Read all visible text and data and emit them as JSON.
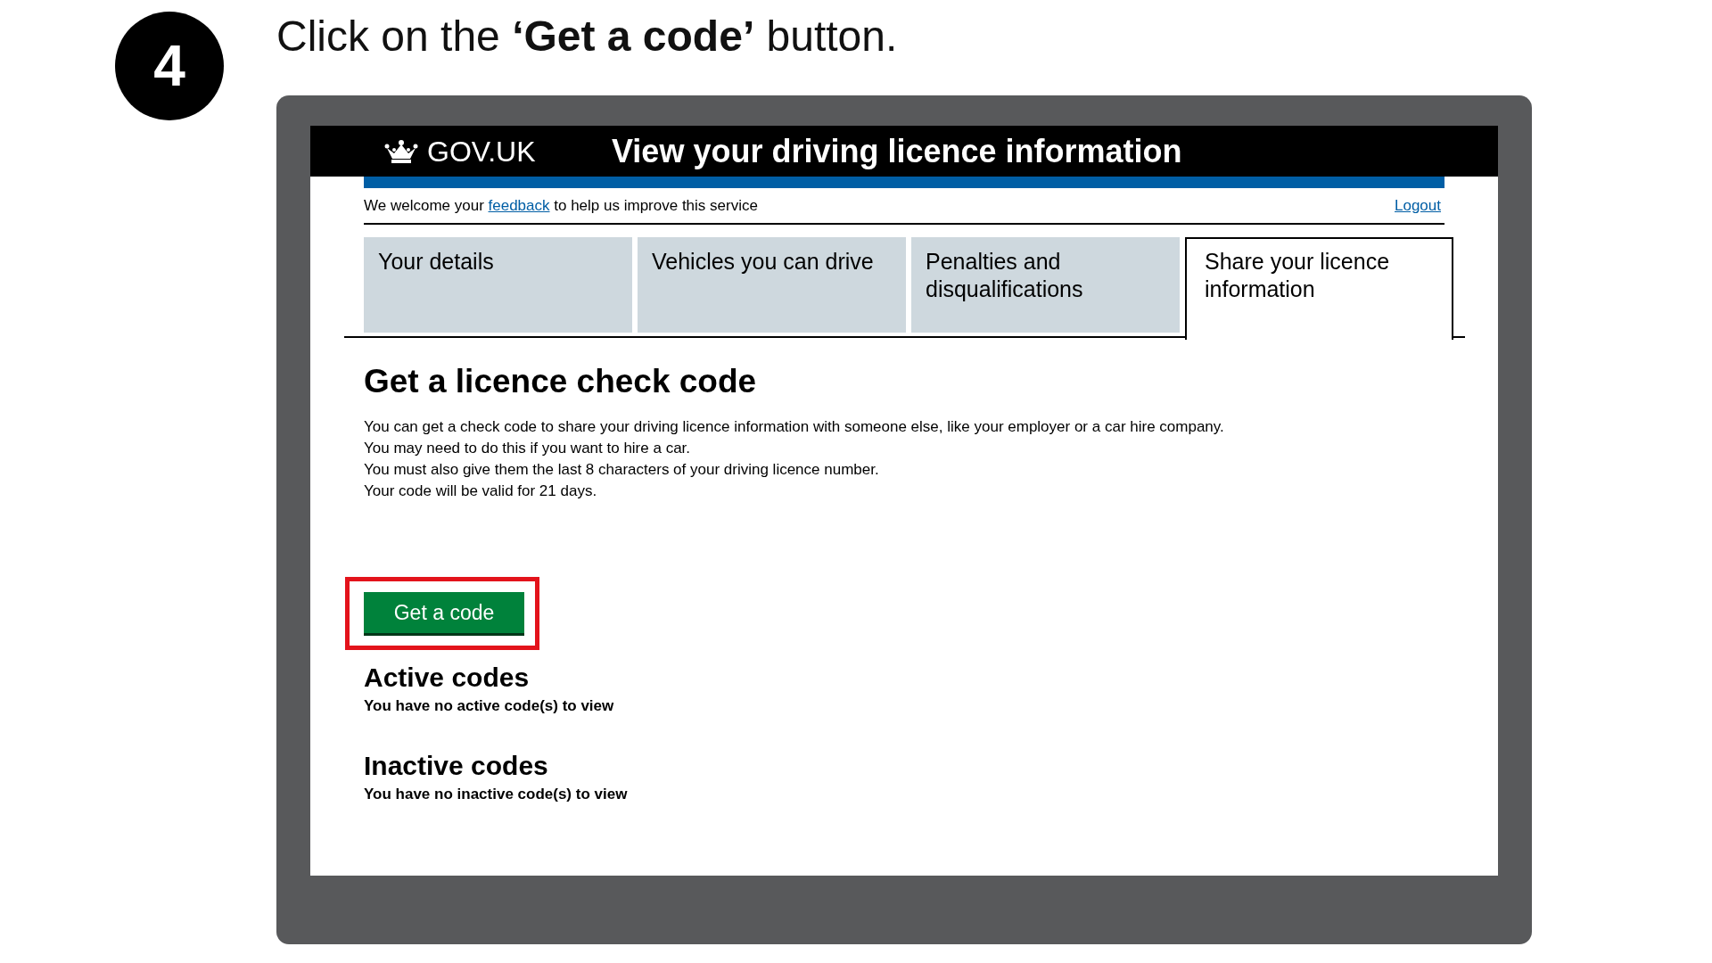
{
  "step": {
    "number": "4",
    "instruction": "Click on the **‘Get a code’** button."
  },
  "header": {
    "logo": "GOV.UK",
    "title": "View your driving licence information"
  },
  "feedback_bar": {
    "text_before": "We welcome your",
    "link": "feedback",
    "text_after": "to help us improve this service",
    "logout": "Logout"
  },
  "tabs": [
    {
      "label": "Your details",
      "selected": false
    },
    {
      "label": "Vehicles you can drive",
      "selected": false
    },
    {
      "label": "Penalties and disqualifications",
      "selected": false
    },
    {
      "label": "Share your licence information",
      "selected": true
    }
  ],
  "content": {
    "heading": "Get a licence check code",
    "paragraphs": [
      "You can get a check code to share your driving licence information with someone else, like your employer or a car hire company.",
      "You may need to do this if you want to hire a car.",
      "You must also give them the last 8 characters of your driving licence number.",
      "Your code will be valid for 21 days."
    ],
    "button": {
      "label": "Get a code",
      "highlighted": true
    },
    "sections": [
      {
        "heading": "Active codes",
        "text": "You have no active code(s) to view"
      },
      {
        "heading": "Inactive codes",
        "text": "You have no inactive code(s) to view"
      }
    ]
  }
}
